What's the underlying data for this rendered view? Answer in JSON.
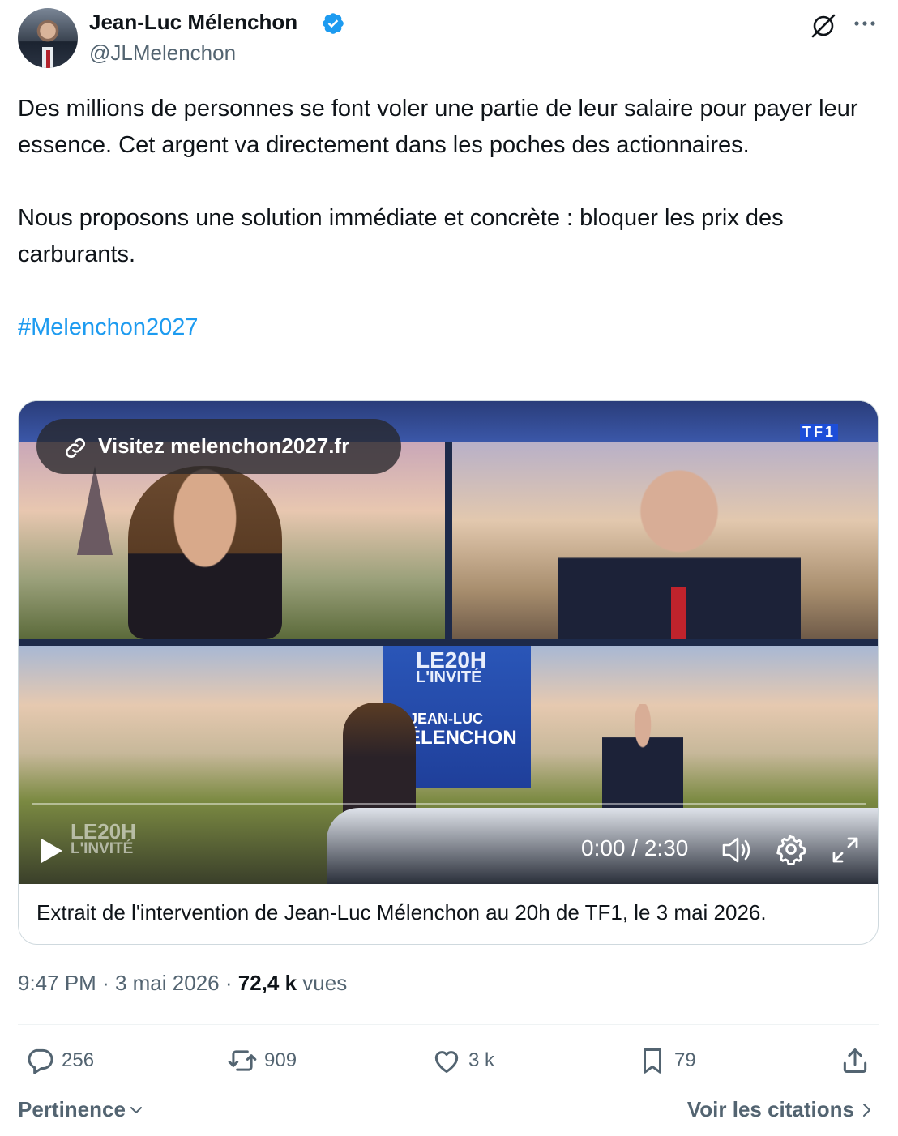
{
  "author": {
    "name": "Jean-Luc Mélenchon",
    "handle": "@JLMelenchon",
    "verified": true
  },
  "post": {
    "paragraphs": [
      "Des millions de personnes se font voler une partie de leur salaire pour payer leur essence. Cet argent va directement dans les poches des actionnaires.",
      "Nous proposons une solution immédiate et concrète : bloquer les prix des carburants."
    ],
    "hashtag": "#Melenchon2027"
  },
  "media": {
    "link_pill": "Visitez melenchon2027.fr",
    "channel_logo": "TF1",
    "screen_text": {
      "show_line1": "LE20H",
      "show_line2": "L'INVITÉ",
      "guest_first": "JEAN-LUC",
      "guest_last": "MÉLENCHON"
    },
    "watermark": {
      "line1": "LE20H",
      "line2": "L'INVITÉ"
    },
    "time": "0:00 / 2:30",
    "progress": 0,
    "caption": "Extrait de l'intervention de Jean-Luc Mélenchon au 20h de TF1, le 3 mai 2026."
  },
  "meta": {
    "time": "9:47 PM",
    "separator": "·",
    "date": "3 mai 2026",
    "views_count": "72,4 k",
    "views_label": "vues"
  },
  "actions": {
    "replies": "256",
    "reposts": "909",
    "likes": "3 k",
    "bookmarks": "79"
  },
  "footer": {
    "sort_label": "Pertinence",
    "quotes_label": "Voir les citations"
  },
  "colors": {
    "accent": "#1d9bf0",
    "text": "#0f1419",
    "secondary": "#536471"
  }
}
